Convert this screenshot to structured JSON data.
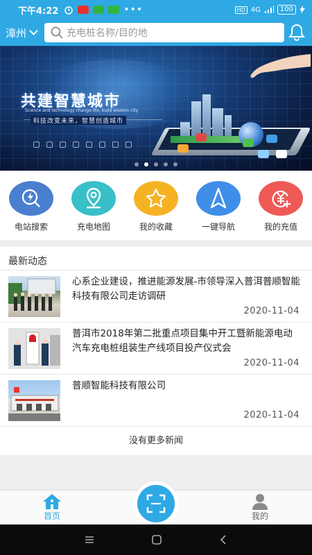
{
  "status_bar": {
    "time": "下午4:22",
    "network": "4G",
    "battery": "100"
  },
  "header": {
    "city": "漳州",
    "search_placeholder": "充电桩名称/目的地",
    "bell_icon": "bell-icon"
  },
  "banner": {
    "title": "共建智慧城市",
    "subtitle_en": "Science and technology change life, build wisdom city",
    "subtitle_cn": "科技改变未来，智慧创造城市",
    "page_count": 5,
    "active_page": 2
  },
  "quick_menu": [
    {
      "label": "电站搜索",
      "icon": "lightning-search-icon",
      "color": "#4a7fd0"
    },
    {
      "label": "充电地图",
      "icon": "map-pin-icon",
      "color": "#38bfc8"
    },
    {
      "label": "我的收藏",
      "icon": "star-icon",
      "color": "#f5b324"
    },
    {
      "label": "一键导航",
      "icon": "navigation-arrow-icon",
      "color": "#3f8ee8"
    },
    {
      "label": "我的充值",
      "icon": "yen-coin-icon",
      "color": "#ee5a56"
    }
  ],
  "news": {
    "heading": "最新动态",
    "items": [
      {
        "title": "心系企业建设，推进能源发展-市领导深入普洱普顺智能科技有限公司走访调研",
        "date": "2020-11-04"
      },
      {
        "title": "普洱市2018年第二批重点项目集中开工暨新能源电动汽车充电桩组装生产线项目投产仪式会",
        "date": "2020-11-04"
      },
      {
        "title": "普顺智能科技有限公司",
        "date": "2020-11-04"
      }
    ],
    "no_more": "没有更多新闻"
  },
  "tabbar": {
    "home_label": "首页",
    "mine_label": "我的",
    "scan_icon": "scan-icon"
  },
  "colors": {
    "primary": "#2fa9e4"
  }
}
